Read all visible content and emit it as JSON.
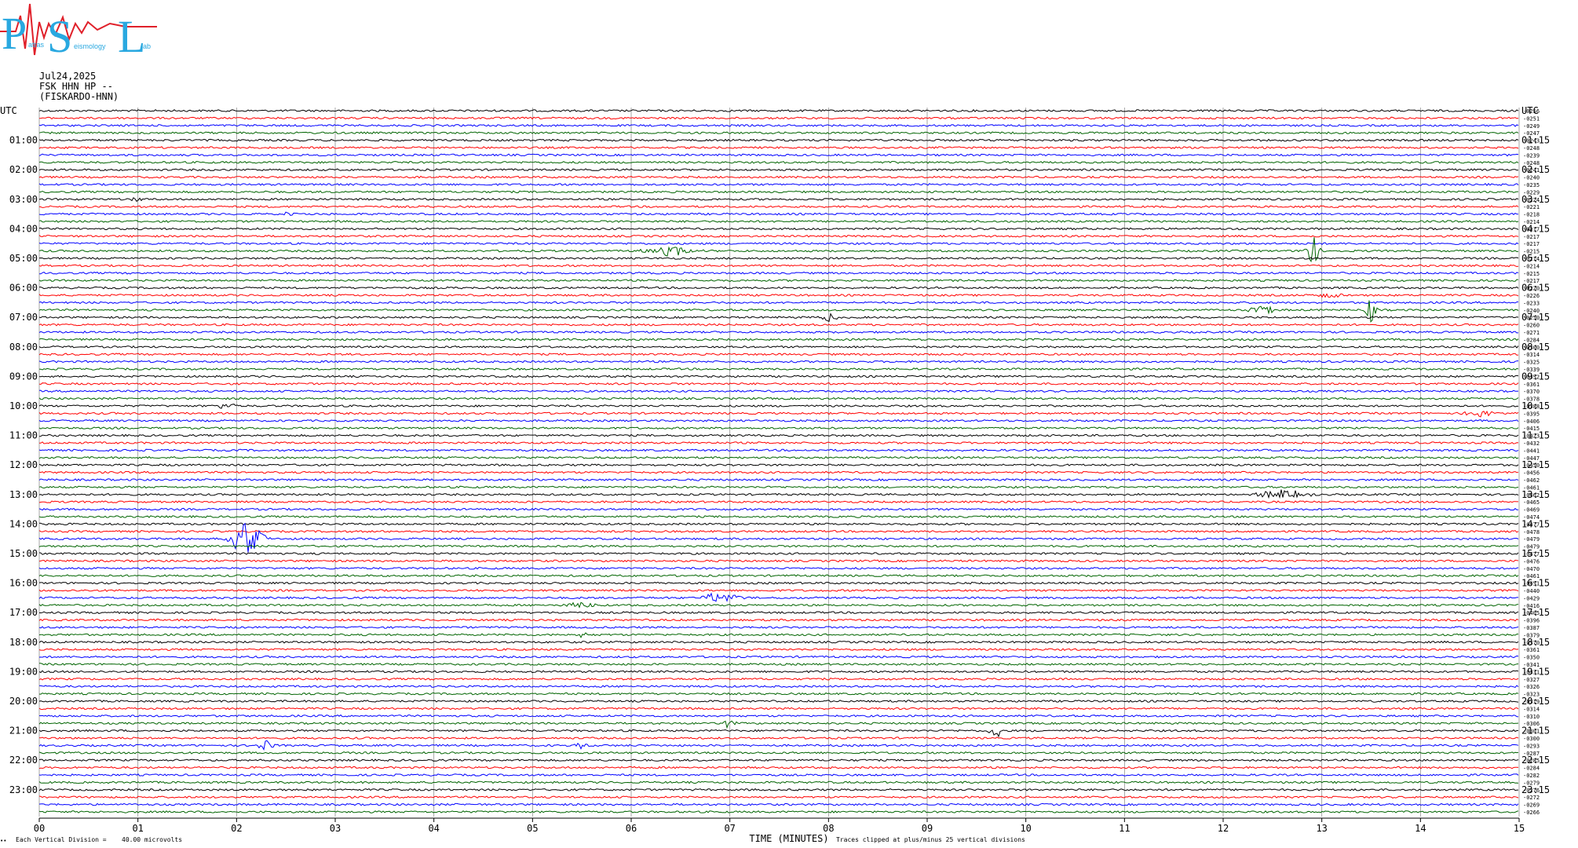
{
  "logo": {
    "big_letters": [
      "P",
      "S",
      "L"
    ],
    "small_text": [
      "atras",
      "eismology",
      "ab"
    ],
    "color": "#29a8e0",
    "trace_color": "#e0202a"
  },
  "header": {
    "date": "Jul24,2025",
    "station": "FSK HHN HP --",
    "name": "(FISKARDO-HNN)"
  },
  "axes": {
    "left_title": "UTC",
    "right_title": "UTC",
    "xlabel": "TIME (MINUTES)"
  },
  "footer": {
    "left_mark": "••",
    "division_label": "Each Vertical Division =",
    "division_value": "40.00 microvolts",
    "clip_note": "Traces clipped at plus/minus 25 vertical divisions"
  },
  "colors": {
    "trace_cycle": [
      "#000000",
      "#ff0000",
      "#0000ff",
      "#006400"
    ],
    "grid": "#909090"
  },
  "chart_data": {
    "type": "line",
    "title": "Jul24,2025 FSK HHN HP -- (FISKARDO-HNN)",
    "xlabel": "TIME (MINUTES)",
    "ylabel": "UTC",
    "xlim": [
      0,
      15
    ],
    "x_ticks": [
      "00",
      "01",
      "02",
      "03",
      "04",
      "05",
      "06",
      "07",
      "08",
      "09",
      "10",
      "11",
      "12",
      "13",
      "14",
      "15"
    ],
    "trace_minutes": 15,
    "trace_count": 96,
    "left_hour_labels": [
      "UTC",
      "01:00",
      "02:00",
      "03:00",
      "04:00",
      "05:00",
      "06:00",
      "07:00",
      "08:00",
      "09:00",
      "10:00",
      "11:00",
      "12:00",
      "13:00",
      "14:00",
      "15:00",
      "16:00",
      "17:00",
      "18:00",
      "19:00",
      "20:00",
      "21:00",
      "22:00",
      "23:00"
    ],
    "right_hour_labels": [
      "UTC",
      "01:15",
      "02:15",
      "03:15",
      "04:15",
      "05:15",
      "06:15",
      "07:15",
      "08:15",
      "09:15",
      "10:15",
      "11:15",
      "12:15",
      "13:15",
      "14:15",
      "15:15",
      "16:15",
      "17:15",
      "18:15",
      "19:15",
      "20:15",
      "21:15",
      "22:15",
      "23:15"
    ],
    "offsets": [
      "-0256",
      "-0251",
      "-0249",
      "-0247",
      "-0243",
      "-0248",
      "-0239",
      "-0248",
      "-0241",
      "-0240",
      "-0235",
      "-0229",
      "-0224",
      "-0221",
      "-0218",
      "-0214",
      "-0217",
      "-0217",
      "-0217",
      "-0215",
      "-0214",
      "-0214",
      "-0215",
      "-0217",
      "-0220",
      "-0226",
      "-0233",
      "-0240",
      "-0250",
      "-0260",
      "-0271",
      "-0284",
      "-0300",
      "-0314",
      "-0325",
      "-0339",
      "-0352",
      "-0361",
      "-0370",
      "-0378",
      "-0388",
      "-0395",
      "-0406",
      "-0415",
      "-0423",
      "-0432",
      "-0441",
      "-0447",
      "-0450",
      "-0456",
      "-0462",
      "-0461",
      "-0462",
      "-0465",
      "-0469",
      "-0474",
      "-0477",
      "-0478",
      "-0479",
      "-0479",
      "-0477",
      "-0476",
      "-0470",
      "-0461",
      "-0451",
      "-0440",
      "-0429",
      "-0416",
      "-0405",
      "-0396",
      "-0387",
      "-0379",
      "-0370",
      "-0361",
      "-0350",
      "-0341",
      "-0331",
      "-0327",
      "-0326",
      "-0323",
      "-0319",
      "-0314",
      "-0310",
      "-0306",
      "-0301",
      "-0300",
      "-0293",
      "-0287",
      "-0285",
      "-0284",
      "-0282",
      "-0279",
      "-0276",
      "-0272",
      "-0269",
      "-0266"
    ],
    "events": [
      {
        "trace": 12,
        "minute": 1.0,
        "amp": 3,
        "dur": 0.1
      },
      {
        "trace": 14,
        "minute": 2.5,
        "amp": 3,
        "dur": 0.1
      },
      {
        "trace": 19,
        "minute": 6.4,
        "amp": 6,
        "dur": 0.4
      },
      {
        "trace": 19,
        "minute": 12.9,
        "amp": 22,
        "dur": 0.1
      },
      {
        "trace": 25,
        "minute": 13.1,
        "amp": 4,
        "dur": 0.2
      },
      {
        "trace": 27,
        "minute": 12.4,
        "amp": 6,
        "dur": 0.2
      },
      {
        "trace": 27,
        "minute": 13.5,
        "amp": 16,
        "dur": 0.08
      },
      {
        "trace": 28,
        "minute": 8.0,
        "amp": 5,
        "dur": 0.15
      },
      {
        "trace": 40,
        "minute": 1.9,
        "amp": 7,
        "dur": 0.1
      },
      {
        "trace": 41,
        "minute": 14.6,
        "amp": 4,
        "dur": 0.2
      },
      {
        "trace": 52,
        "minute": 12.6,
        "amp": 6,
        "dur": 0.4
      },
      {
        "trace": 58,
        "minute": 2.1,
        "amp": 22,
        "dur": 0.25
      },
      {
        "trace": 66,
        "minute": 6.9,
        "amp": 7,
        "dur": 0.3
      },
      {
        "trace": 67,
        "minute": 5.5,
        "amp": 5,
        "dur": 0.2
      },
      {
        "trace": 71,
        "minute": 5.5,
        "amp": 4,
        "dur": 0.1
      },
      {
        "trace": 84,
        "minute": 9.7,
        "amp": 8,
        "dur": 0.12
      },
      {
        "trace": 83,
        "minute": 7.0,
        "amp": 7,
        "dur": 0.1
      },
      {
        "trace": 86,
        "minute": 2.3,
        "amp": 8,
        "dur": 0.12
      },
      {
        "trace": 86,
        "minute": 5.5,
        "amp": 5,
        "dur": 0.1
      }
    ]
  }
}
